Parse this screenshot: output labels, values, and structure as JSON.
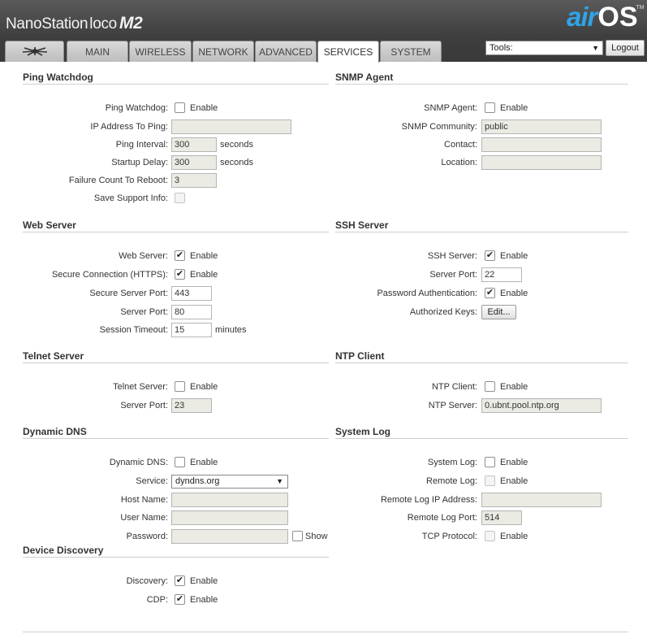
{
  "header": {
    "brand_name": "NanoStation",
    "brand_model": "loco",
    "brand_suffix": "M2",
    "airos_air": "air",
    "airos_os": "OS",
    "airos_tm": "TM"
  },
  "tabs": [
    {
      "label": "MAIN"
    },
    {
      "label": "WIRELESS"
    },
    {
      "label": "NETWORK"
    },
    {
      "label": "ADVANCED"
    },
    {
      "label": "SERVICES",
      "active": true
    },
    {
      "label": "SYSTEM"
    }
  ],
  "tools": {
    "selected": "Tools:",
    "logout_label": "Logout"
  },
  "ping_watchdog": {
    "title": "Ping Watchdog",
    "enable_label": "Ping Watchdog:",
    "enable_text": "Enable",
    "enabled": false,
    "ip_label": "IP Address To Ping:",
    "ip_value": "",
    "interval_label": "Ping Interval:",
    "interval_value": "300",
    "interval_unit": "seconds",
    "delay_label": "Startup Delay:",
    "delay_value": "300",
    "delay_unit": "seconds",
    "failure_label": "Failure Count To Reboot:",
    "failure_value": "3",
    "support_label": "Save Support Info:"
  },
  "snmp": {
    "title": "SNMP Agent",
    "agent_label": "SNMP Agent:",
    "enable_text": "Enable",
    "enabled": false,
    "community_label": "SNMP Community:",
    "community_value": "public",
    "contact_label": "Contact:",
    "contact_value": "",
    "location_label": "Location:",
    "location_value": ""
  },
  "web_server": {
    "title": "Web Server",
    "server_label": "Web Server:",
    "enable_text": "Enable",
    "enabled": true,
    "https_label": "Secure Connection (HTTPS):",
    "https_enabled": true,
    "secure_port_label": "Secure Server Port:",
    "secure_port_value": "443",
    "port_label": "Server Port:",
    "port_value": "80",
    "timeout_label": "Session Timeout:",
    "timeout_value": "15",
    "timeout_unit": "minutes"
  },
  "ssh_server": {
    "title": "SSH Server",
    "server_label": "SSH Server:",
    "enable_text": "Enable",
    "enabled": true,
    "port_label": "Server Port:",
    "port_value": "22",
    "password_label": "Password Authentication:",
    "password_enabled": true,
    "keys_label": "Authorized Keys:",
    "edit_label": "Edit..."
  },
  "telnet_server": {
    "title": "Telnet Server",
    "server_label": "Telnet Server:",
    "enable_text": "Enable",
    "enabled": false,
    "port_label": "Server Port:",
    "port_value": "23"
  },
  "ntp_client": {
    "title": "NTP Client",
    "client_label": "NTP Client:",
    "enable_text": "Enable",
    "enabled": false,
    "server_label": "NTP Server:",
    "server_value": "0.ubnt.pool.ntp.org"
  },
  "dynamic_dns": {
    "title": "Dynamic DNS",
    "ddns_label": "Dynamic DNS:",
    "enable_text": "Enable",
    "enabled": false,
    "service_label": "Service:",
    "service_value": "dyndns.org",
    "host_label": "Host Name:",
    "host_value": "",
    "user_label": "User Name:",
    "user_value": "",
    "password_label": "Password:",
    "password_value": "",
    "show_label": "Show"
  },
  "system_log": {
    "title": "System Log",
    "log_label": "System Log:",
    "enable_text": "Enable",
    "enabled": false,
    "remote_label": "Remote Log:",
    "remote_enabled": false,
    "remote_ip_label": "Remote Log IP Address:",
    "remote_ip_value": "",
    "remote_port_label": "Remote Log Port:",
    "remote_port_value": "514",
    "tcp_label": "TCP Protocol:",
    "tcp_enabled": false
  },
  "device_discovery": {
    "title": "Device Discovery",
    "discovery_label": "Discovery:",
    "enable_text": "Enable",
    "discovery_enabled": true,
    "cdp_label": "CDP:",
    "cdp_enabled": true
  }
}
